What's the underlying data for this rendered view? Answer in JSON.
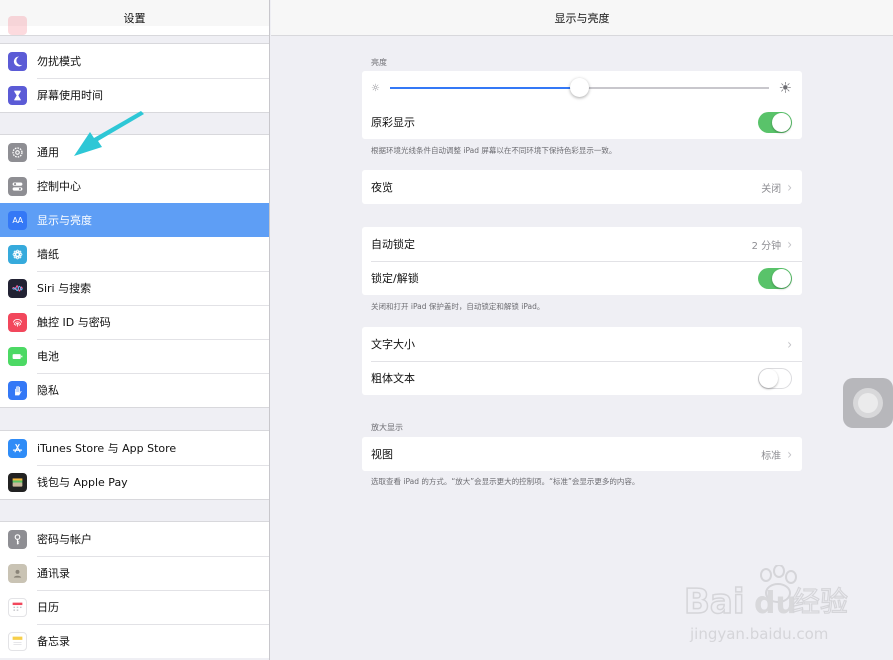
{
  "sidebar": {
    "title": "设置",
    "group1": [
      {
        "label": "勿扰模式",
        "icon": "moon-icon",
        "color": "#5b5bd6"
      },
      {
        "label": "屏幕使用时间",
        "icon": "hourglass-icon",
        "color": "#5b5bd6"
      }
    ],
    "group2": [
      {
        "label": "通用",
        "icon": "gear-icon",
        "color": "#8e8e93"
      },
      {
        "label": "控制中心",
        "icon": "toggles-icon",
        "color": "#8e8e93"
      },
      {
        "label": "显示与亮度",
        "icon": "text-size-icon",
        "color": "#3478f6",
        "active": true
      },
      {
        "label": "墙纸",
        "icon": "flower-icon",
        "color": "#36aadc"
      },
      {
        "label": "Siri 与搜索",
        "icon": "siri-icon",
        "color": "#222233"
      },
      {
        "label": "触控 ID 与密码",
        "icon": "fingerprint-icon",
        "color": "#f2475c"
      },
      {
        "label": "电池",
        "icon": "battery-icon",
        "color": "#4cd964"
      },
      {
        "label": "隐私",
        "icon": "hand-icon",
        "color": "#3478f6"
      }
    ],
    "group3": [
      {
        "label": "iTunes Store 与 App Store",
        "icon": "app-store-icon",
        "color": "#2f8cf7"
      },
      {
        "label": "钱包与 Apple Pay",
        "icon": "wallet-icon",
        "color": "#222222"
      }
    ],
    "group4": [
      {
        "label": "密码与帐户",
        "icon": "key-icon",
        "color": "#8e8e93"
      },
      {
        "label": "通讯录",
        "icon": "contacts-icon",
        "color": "#b9b3a4"
      },
      {
        "label": "日历",
        "icon": "calendar-icon",
        "color": "#ffffff"
      },
      {
        "label": "备忘录",
        "icon": "notes-icon",
        "color": "#ffffff"
      }
    ]
  },
  "detail": {
    "title": "显示与亮度",
    "brightness": {
      "header": "亮度",
      "level": 0.5,
      "true_tone_label": "原彩显示",
      "true_tone_on": true,
      "footer": "根据环境光线条件自动调整 iPad 屏幕以在不同环境下保持色彩显示一致。"
    },
    "night_shift": {
      "label": "夜览",
      "value": "关闭"
    },
    "lock": {
      "auto_lock_label": "自动锁定",
      "auto_lock_value": "2 分钟",
      "lock_unlock_label": "锁定/解锁",
      "lock_unlock_on": true,
      "footer": "关闭和打开 iPad 保护盖时，自动锁定和解锁 iPad。"
    },
    "text": {
      "text_size_label": "文字大小",
      "bold_text_label": "粗体文本",
      "bold_text_on": false
    },
    "zoom": {
      "header": "放大显示",
      "view_label": "视图",
      "view_value": "标准",
      "footer": "选取查看 iPad 的方式。“放大”会显示更大的控制项。“标准”会显示更多的内容。"
    }
  },
  "colors": {
    "accent": "#3478f6",
    "active_row": "#5e9ef5",
    "toggle_on": "#59c36a",
    "annotation_arrow": "#2ec7d6"
  },
  "watermark": {
    "brand": "Bai",
    "brand2": "du",
    "suffix": "经验",
    "url": "jingyan.baidu.com"
  }
}
